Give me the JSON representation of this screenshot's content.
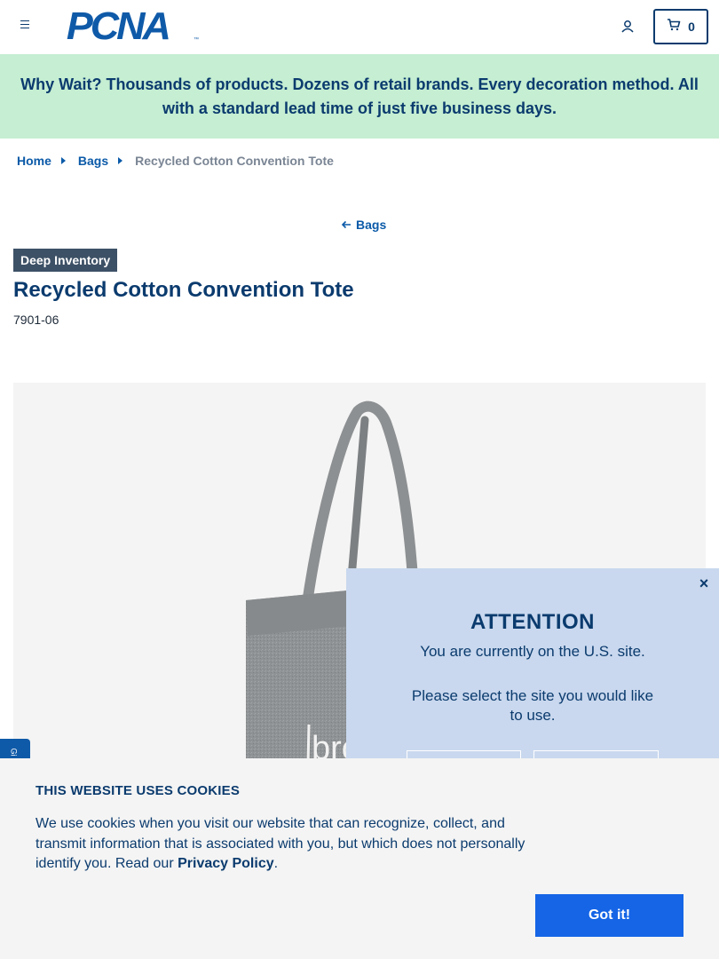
{
  "header": {
    "logo_text": "PCNA",
    "logo_tm": "™",
    "cart_count": "0"
  },
  "banner": {
    "text": "Why Wait? Thousands of products. Dozens of retail brands. Every decoration method. All with a standard lead time of just five business days."
  },
  "breadcrumb": {
    "items": [
      "Home",
      "Bags"
    ],
    "current": "Recycled Cotton Convention Tote"
  },
  "back_link": {
    "label": "Bags"
  },
  "product": {
    "badge": "Deep Inventory",
    "title": "Recycled Cotton Convention Tote",
    "sku": "7901-06",
    "image_text": "bro"
  },
  "attention": {
    "title": "ATTENTION",
    "line1": "You are currently on the U.S. site.",
    "line2": "Please select the site you would like to use.",
    "close": "×"
  },
  "cookie": {
    "title": "THIS WEBSITE USES COOKIES",
    "text": "We use cookies when you visit our website that can recognize, collect, and transmit information that is associated with you, but which does not personally identify you. Read our ",
    "link": "Privacy Policy",
    "period": ".",
    "button": "Got it!"
  },
  "side_tab": {
    "label": "Gi"
  },
  "colors": {
    "navy": "#0b3b6e",
    "brand_blue": "#0f5aa8",
    "banner_green": "#c5eed2",
    "attention_bg": "#c9d8ee",
    "cookie_button": "#1565e6",
    "badge_bg": "#3d5166"
  },
  "icons": {
    "menu": "hamburger-menu-icon",
    "account": "user-icon",
    "cart": "shopping-cart-icon",
    "back": "arrow-left-icon",
    "close": "close-icon",
    "crumb_sep": "caret-right-icon"
  }
}
